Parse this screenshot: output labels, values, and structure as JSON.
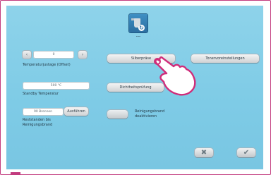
{
  "device": {
    "selected_program_label": "•••"
  },
  "left": {
    "temp_value": "0",
    "temp_label": "Temperaturjustage (Offset)",
    "standby_value": "500 °C",
    "standby_label": "Standby Temperatur",
    "rest_value": "90 Brennen",
    "rest_button": "Ausführen",
    "rest_label_line1": "Reststanden bis",
    "rest_label_line2": "Reinigungsbrand"
  },
  "buttons": {
    "btn1": "Silberpräse",
    "btn2": "Tonervoreinstellungen",
    "btn3": "Dichtheitsprüfung",
    "toggle_label_line1": "Reinigungsbrand",
    "toggle_label_line2": "deaktivieren"
  },
  "actions": {
    "cancel_symbol": "✖",
    "confirm_symbol": "✔"
  },
  "colors": {
    "panel": "#7ecbe6",
    "frame": "#c23b7e",
    "hand_fill": "#ffffff",
    "hand_outline": "#d02d7a"
  },
  "icons": {
    "device": "furnace-icon",
    "pointer": "hand-pointer-icon"
  }
}
